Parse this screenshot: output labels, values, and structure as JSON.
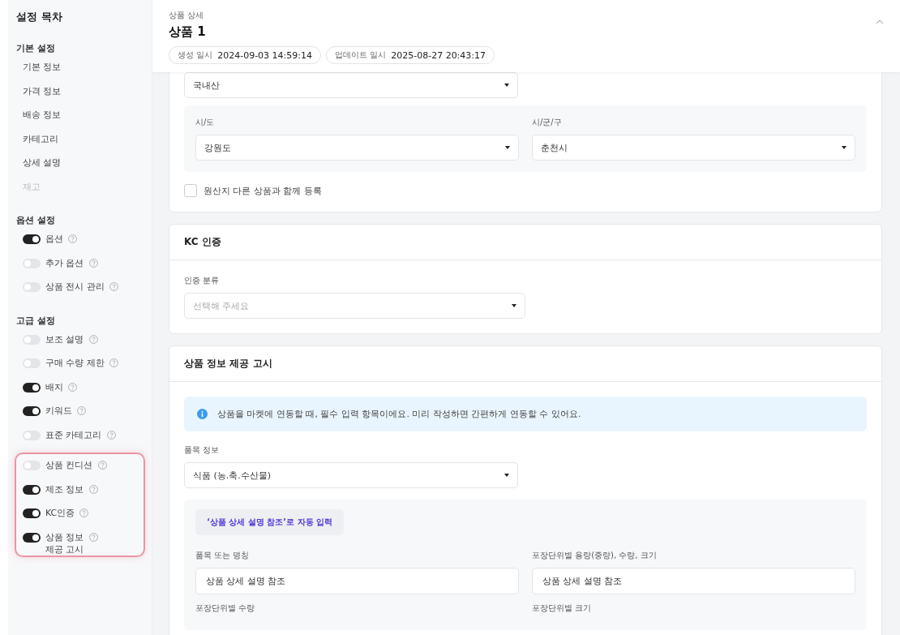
{
  "sidebar": {
    "title": "설정 목차",
    "sections": [
      {
        "heading": "기본 설정",
        "items": [
          {
            "kind": "link",
            "label": "기본 정보",
            "disabled": false
          },
          {
            "kind": "link",
            "label": "가격 정보",
            "disabled": false
          },
          {
            "kind": "link",
            "label": "배송 정보",
            "disabled": false
          },
          {
            "kind": "link",
            "label": "카테고리",
            "disabled": false
          },
          {
            "kind": "link",
            "label": "상세 설명",
            "disabled": false
          },
          {
            "kind": "link",
            "label": "재고",
            "disabled": true
          }
        ]
      },
      {
        "heading": "옵션 설정",
        "items": [
          {
            "kind": "toggle",
            "label": "옵션",
            "on": true,
            "highlighted": false
          },
          {
            "kind": "toggle",
            "label": "추가 옵션",
            "on": false,
            "highlighted": false
          },
          {
            "kind": "toggle",
            "label": "상품 전시 관리",
            "on": false,
            "highlighted": false
          }
        ]
      },
      {
        "heading": "고급 설정",
        "items": [
          {
            "kind": "toggle",
            "label": "보조 설명",
            "on": false,
            "highlighted": false
          },
          {
            "kind": "toggle",
            "label": "구매 수량 제한",
            "on": false,
            "highlighted": false
          },
          {
            "kind": "toggle",
            "label": "배지",
            "on": true,
            "highlighted": false
          },
          {
            "kind": "toggle",
            "label": "키워드",
            "on": true,
            "highlighted": false
          },
          {
            "kind": "toggle",
            "label": "표준 카테고리",
            "on": false,
            "highlighted": false
          },
          {
            "kind": "toggle",
            "label": "상품 컨디션",
            "on": false,
            "highlighted": true
          },
          {
            "kind": "toggle",
            "label": "제조 정보",
            "on": true,
            "highlighted": true
          },
          {
            "kind": "toggle",
            "label": "KC인증",
            "on": true,
            "highlighted": true
          },
          {
            "kind": "toggle",
            "label": "상품 정보\n제공 고시",
            "on": true,
            "highlighted": true
          }
        ]
      }
    ]
  },
  "header": {
    "breadcrumb": "상품 상세",
    "title": "상품 1",
    "meta": [
      {
        "label": "생성 일시",
        "value": "2024-09-03 14:59:14"
      },
      {
        "label": "업데이트 일시",
        "value": "2025-08-27 20:43:17"
      }
    ]
  },
  "origin_card": {
    "origin_select": "국내산",
    "region": [
      {
        "label": "시/도",
        "value": "강원도"
      },
      {
        "label": "시/군/구",
        "value": "춘천시"
      }
    ],
    "checkbox": {
      "label": "원산지 다른 상품과 함께 등록",
      "checked": false
    }
  },
  "kc_card": {
    "title": "KC 인증",
    "field": {
      "label": "인증 분류",
      "placeholder": "선택해 주세요"
    }
  },
  "notice_card": {
    "title": "상품 정보 제공 고시",
    "info": "상품을 마켓에 연동할 때, 필수 입력 항목이에요. 미리 작성하면 간편하게 연동할 수 있어요.",
    "category": {
      "label": "품목 정보",
      "value": "식품 (농.축.수산물)"
    },
    "autofill_button": "‘상품 상세 설명 참조’로 자동 입력",
    "fields": [
      {
        "label": "품목 또는 명칭",
        "value": "상품 상세 설명 참조"
      },
      {
        "label": "포장단위별 용량(중량), 수량, 크기",
        "value": "상품 상세 설명 참조"
      },
      {
        "label": "포장단위별 수량"
      },
      {
        "label": "포장단위별 크기"
      }
    ]
  }
}
